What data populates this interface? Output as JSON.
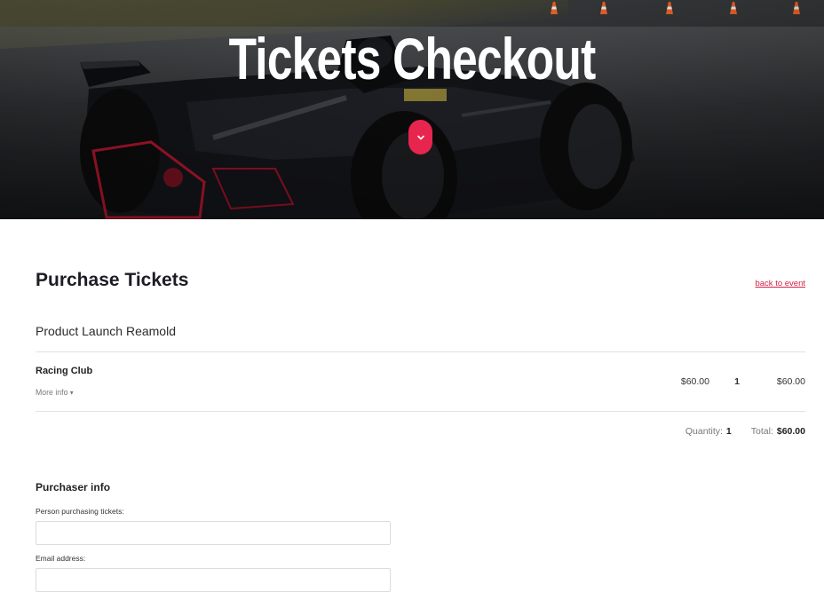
{
  "hero": {
    "title": "Tickets Checkout",
    "scroll_icon": "chevron-down-icon"
  },
  "purchase": {
    "title": "Purchase Tickets",
    "back_link": "back to event",
    "event_name": "Product Launch Reamold"
  },
  "ticket": {
    "name": "Racing Club",
    "more_info": "More info",
    "more_info_icon": "caret-down-icon",
    "price": "$60.00",
    "quantity": "1",
    "total": "$60.00"
  },
  "summary": {
    "quantity_label": "Quantity:",
    "quantity_value": "1",
    "total_label": "Total:",
    "total_value": "$60.00"
  },
  "purchaser": {
    "title": "Purchaser info",
    "person_label": "Person purchasing tickets:",
    "person_value": "",
    "email_label": "Email address:",
    "email_value": ""
  },
  "colors": {
    "accent": "#e8254f",
    "link": "#d31f4a"
  }
}
